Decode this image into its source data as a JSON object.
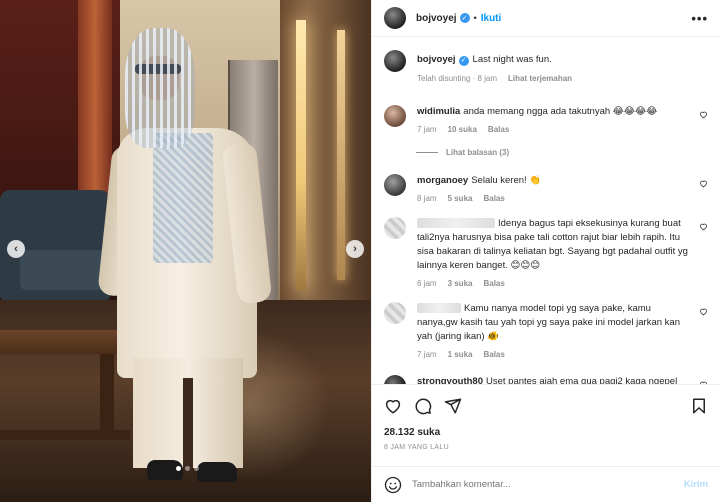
{
  "post": {
    "author": "bojvoyej",
    "follow_label": "Ikuti",
    "more_label": "•••",
    "verified_mark": "✓"
  },
  "media": {
    "prev_label": "‹",
    "next_label": "›",
    "carousel_dots": 3,
    "active_dot": 1
  },
  "caption": {
    "username": "bojvoyej",
    "text": "Last night was fun.",
    "edited_time": "Telah disunting · 8 jam",
    "translate_label": "Lihat terjemahan"
  },
  "comments": [
    {
      "username": "widimulia",
      "text": "anda memang ngga ada takutnyah 😂😂😂😂",
      "time": "7 jam",
      "likes": "10 suka",
      "reply_label": "Balas",
      "view_replies": "Lihat balasan (3)"
    },
    {
      "username": "morganoey",
      "text": "Selalu keren! 👏",
      "time": "8 jam",
      "likes": "5 suka",
      "reply_label": "Balas"
    },
    {
      "username": "",
      "text": "Idenya bagus tapi eksekusinya kurang buat tali2nya harusnya bisa pake tali cotton rajut biar lebih rapih. Itu sisa bakaran di talinya keliatan bgt. Sayang bgt padahal outfit yg lainnya keren banget. 😊😊😊",
      "time": "6 jam",
      "likes": "3 suka",
      "reply_label": "Balas"
    },
    {
      "username": "",
      "text": "Kamu nanya model topi yg saya pake, kamu nanya,gw kasih tau yah topi yg saya pake ini model jarkan kan yah (jaring ikan) 🐠",
      "time": "7 jam",
      "likes": "1 suka",
      "reply_label": "Balas"
    },
    {
      "username": "strongyouth80",
      "text": "Uset pantes ajah ema gua pagi2 kaga ngepel"
    }
  ],
  "footer": {
    "likes": "28.132 suka",
    "time": "8 JAM YANG LALU",
    "comment_placeholder": "Tambahkan komentar...",
    "post_label": "Kirim"
  },
  "icons": {
    "heart": "heart-icon",
    "comment": "comment-icon",
    "share": "share-icon",
    "save": "bookmark-icon",
    "emoji": "emoji-icon",
    "small_heart": "small-heart-icon"
  },
  "colors": {
    "link_blue": "#0095f6",
    "muted": "#8e8e8e",
    "text": "#262626",
    "post_disabled": "#b2dffc",
    "verified": "#3897f0"
  }
}
